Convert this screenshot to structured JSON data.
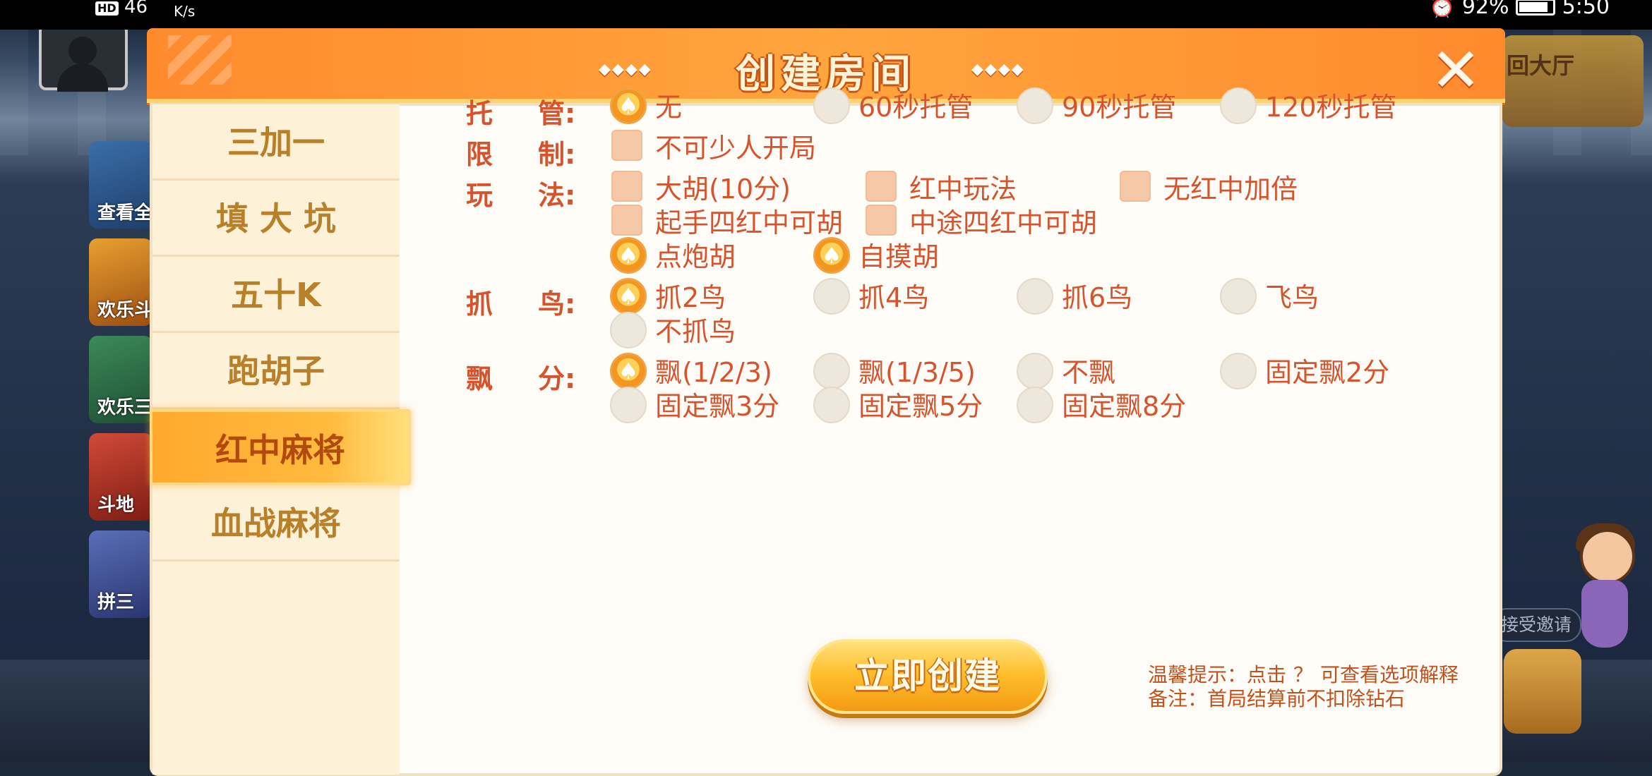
{
  "status_bar": {
    "hd_label": "HD",
    "signal": "46",
    "speed": "K/s",
    "battery": "92%",
    "time": "5:50"
  },
  "lobby": {
    "games": [
      {
        "label": "查看全"
      },
      {
        "label": "欢乐斗"
      },
      {
        "label": "欢乐三"
      },
      {
        "label": "斗地"
      },
      {
        "label": "拼三"
      }
    ],
    "return_hall": "回大厅",
    "accept_invite": "接受邀请"
  },
  "dialog": {
    "title": "创建房间",
    "title_deco_left": "◆◆◆◆",
    "title_deco_right": "◆◆◆◆",
    "close_label": "✕"
  },
  "sidebar": {
    "items": [
      {
        "label": "三加一"
      },
      {
        "label": "填 大 坑"
      },
      {
        "label": "五十K"
      },
      {
        "label": "跑胡子"
      },
      {
        "label": "红中麻将",
        "active": true
      },
      {
        "label": "血战麻将"
      }
    ]
  },
  "options": {
    "tuoguan": {
      "label_1": "托",
      "label_2": "管:",
      "choices": [
        {
          "label": "无",
          "selected": true
        },
        {
          "label": "60秒托管",
          "selected": false
        },
        {
          "label": "90秒托管",
          "selected": false
        },
        {
          "label": "120秒托管",
          "selected": false
        }
      ]
    },
    "xianzhi": {
      "label_1": "限",
      "label_2": "制:",
      "choices": [
        {
          "label": "不可少人开局",
          "checked": false
        }
      ]
    },
    "wanfa": {
      "label_1": "玩",
      "label_2": "法:",
      "checks": [
        {
          "label": "大胡(10分)",
          "checked": false
        },
        {
          "label": "红中玩法",
          "checked": false
        },
        {
          "label": "无红中加倍",
          "checked": false
        },
        {
          "label": "起手四红中可胡",
          "checked": false
        },
        {
          "label": "中途四红中可胡",
          "checked": false
        }
      ],
      "radios": [
        {
          "label": "点炮胡",
          "selected": true
        },
        {
          "label": "自摸胡",
          "selected": true
        }
      ]
    },
    "zhuaniao": {
      "label_1": "抓",
      "label_2": "鸟:",
      "choices": [
        {
          "label": "抓2鸟",
          "selected": true
        },
        {
          "label": "抓4鸟",
          "selected": false
        },
        {
          "label": "抓6鸟",
          "selected": false
        },
        {
          "label": "飞鸟",
          "selected": false
        },
        {
          "label": "不抓鸟",
          "selected": false
        }
      ]
    },
    "piaofen": {
      "label_1": "飘",
      "label_2": "分:",
      "choices": [
        {
          "label": "飘(1/2/3)",
          "selected": true
        },
        {
          "label": "飘(1/3/5)",
          "selected": false
        },
        {
          "label": "不飘",
          "selected": false
        },
        {
          "label": "固定飘2分",
          "selected": false
        },
        {
          "label": "固定飘3分",
          "selected": false
        },
        {
          "label": "固定飘5分",
          "selected": false
        },
        {
          "label": "固定飘8分",
          "selected": false
        }
      ]
    }
  },
  "footer": {
    "create_label": "立即创建",
    "tip_prefix": "温馨提示：点击",
    "tip_q": "？",
    "tip_suffix": "可查看选项解释",
    "note": "备注：首局结算前不扣除钻石"
  },
  "colors": {
    "accent": "#ff9a2e",
    "label_red": "#d5542d",
    "sidebar_text": "#b9802a",
    "sidebar_bg": "#fdf1d8",
    "panel_bg": "#fefcf6"
  }
}
